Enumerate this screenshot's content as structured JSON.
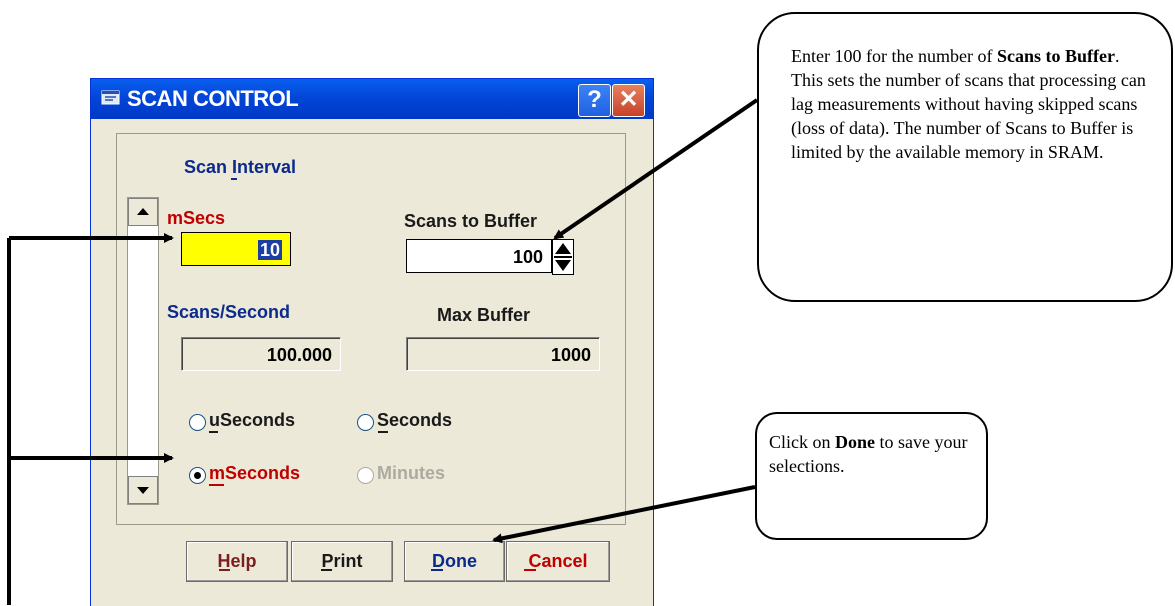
{
  "window": {
    "title": "SCAN CONTROL",
    "help_glyph": "?",
    "close_glyph": "✕"
  },
  "scan_interval": {
    "group_label": "Scan Interval",
    "msecs_label": "mSecs",
    "msecs_value": "10",
    "scans_to_buffer_label": "Scans to Buffer",
    "scans_to_buffer_value": "100",
    "scans_per_second_label": "Scans/Second",
    "scans_per_second_value": "100.000",
    "max_buffer_label": "Max Buffer",
    "max_buffer_value": "1000"
  },
  "units": {
    "useconds": "uSeconds",
    "seconds": "Seconds",
    "mseconds": "mSeconds",
    "minutes": "Minutes",
    "selected": "mSeconds"
  },
  "buttons": {
    "help": "Help",
    "print": "Print",
    "done": "Done",
    "cancel": "Cancel"
  },
  "callouts": {
    "buffer_prefix": "Enter 100 for the number of",
    "buffer_bold": "Scans to Buffer",
    "buffer_rest": ". This sets the number of scans that processing can lag measurements without having skipped scans (loss of data). The number of Scans to Buffer is limited by the available memory in SRAM.",
    "done_prefix": "Click on",
    "done_bold": "Done",
    "done_rest": "to save your selections."
  },
  "colors": {
    "window_face": "#ECE9D8",
    "title_blue": "#0246D8",
    "active_field": "#FFFF00",
    "label_red": "#C00000",
    "label_blue": "#0B2A8C"
  }
}
